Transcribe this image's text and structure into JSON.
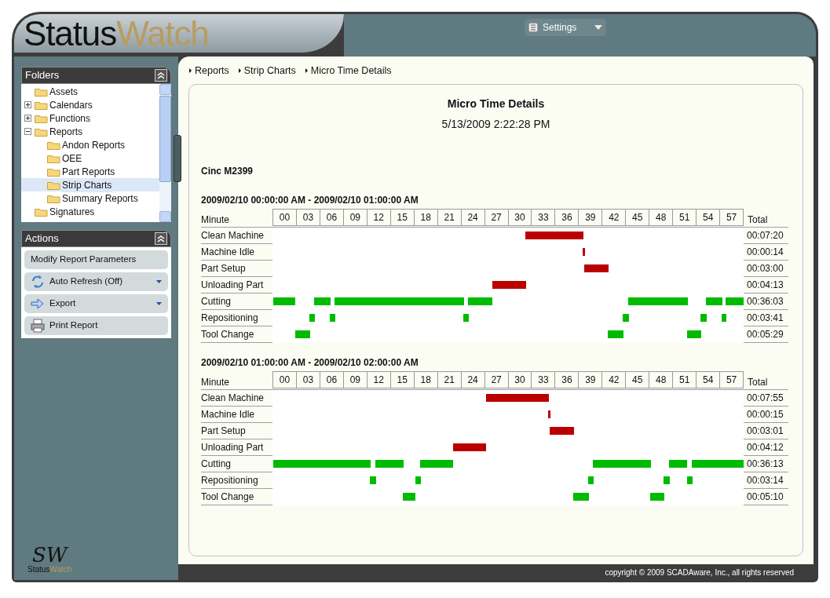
{
  "header": {
    "logo": {
      "first": "Status",
      "second": "Watch"
    },
    "settings_menu": {
      "label": "Settings"
    }
  },
  "breadcrumbs": [
    "Reports",
    "Strip Charts",
    "Micro Time Details"
  ],
  "folders_panel": {
    "title": "Folders",
    "tree": [
      {
        "label": "Assets",
        "selected": false
      },
      {
        "label": "Calendars",
        "selected": false,
        "expanded": false
      },
      {
        "label": "Functions",
        "selected": false,
        "expanded": false
      },
      {
        "label": "Reports",
        "selected": false,
        "expanded": true,
        "children": [
          {
            "label": "Andon Reports",
            "selected": false
          },
          {
            "label": "OEE",
            "selected": false
          },
          {
            "label": "Part Reports",
            "selected": false
          },
          {
            "label": "Strip Charts",
            "selected": true
          },
          {
            "label": "Summary Reports",
            "selected": false
          }
        ]
      },
      {
        "label": "Signatures",
        "selected": false
      }
    ]
  },
  "actions_panel": {
    "title": "Actions",
    "actions": [
      {
        "kind": "plain",
        "label": "Modify Report Parameters"
      },
      {
        "kind": "refresh",
        "label": "Auto Refresh (Off)",
        "dropdown": true
      },
      {
        "kind": "export",
        "label": "Export",
        "dropdown": true
      },
      {
        "kind": "print",
        "label": "Print Report",
        "dropdown": false
      }
    ]
  },
  "sidebar_logo": {
    "monogram": "SW",
    "first": "Status",
    "second": "Watch"
  },
  "report": {
    "title": "Micro Time Details",
    "timestamp": "5/13/2009 2:22:28 PM",
    "machine": "Cinc M2399",
    "blocks": [
      {
        "period": "2009/02/10 00:00:00 AM - 2009/02/10 01:00:00 AM",
        "minute_label": "Minute",
        "total_label": "Total",
        "minutes": [
          "00",
          "03",
          "06",
          "09",
          "12",
          "15",
          "18",
          "21",
          "24",
          "27",
          "30",
          "33",
          "36",
          "39",
          "42",
          "45",
          "48",
          "51",
          "54",
          "57"
        ],
        "rows": [
          {
            "label": "Clean Machine",
            "total": "00:07:20",
            "color": "#bb0000"
          },
          {
            "label": "Machine Idle",
            "total": "00:00:14",
            "color": "#bb0000"
          },
          {
            "label": "Part Setup",
            "total": "00:03:00",
            "color": "#bb0000"
          },
          {
            "label": "Unloading Part",
            "total": "00:04:13",
            "color": "#bb0000"
          },
          {
            "label": "Cutting",
            "total": "00:36:03",
            "color": "#00bb00"
          },
          {
            "label": "Repositioning",
            "total": "00:03:41",
            "color": "#00bb00"
          },
          {
            "label": "Tool Change",
            "total": "00:05:29",
            "color": "#00bb00"
          }
        ]
      },
      {
        "period": "2009/02/10 01:00:00 AM - 2009/02/10 02:00:00 AM",
        "minute_label": "Minute",
        "total_label": "Total",
        "minutes": [
          "00",
          "03",
          "06",
          "09",
          "12",
          "15",
          "18",
          "21",
          "24",
          "27",
          "30",
          "33",
          "36",
          "39",
          "42",
          "45",
          "48",
          "51",
          "54",
          "57"
        ],
        "rows": [
          {
            "label": "Clean Machine",
            "total": "00:07:55",
            "color": "#bb0000"
          },
          {
            "label": "Machine Idle",
            "total": "00:00:15",
            "color": "#bb0000"
          },
          {
            "label": "Part Setup",
            "total": "00:03:01",
            "color": "#bb0000"
          },
          {
            "label": "Unloading Part",
            "total": "00:04:12",
            "color": "#bb0000"
          },
          {
            "label": "Cutting",
            "total": "00:36:13",
            "color": "#00bb00"
          },
          {
            "label": "Repositioning",
            "total": "00:03:14",
            "color": "#00bb00"
          },
          {
            "label": "Tool Change",
            "total": "00:05:10",
            "color": "#00bb00"
          }
        ]
      }
    ]
  },
  "footer": {
    "copyright": "copyright © 2009 SCADAware, Inc., all rights reserved"
  }
}
